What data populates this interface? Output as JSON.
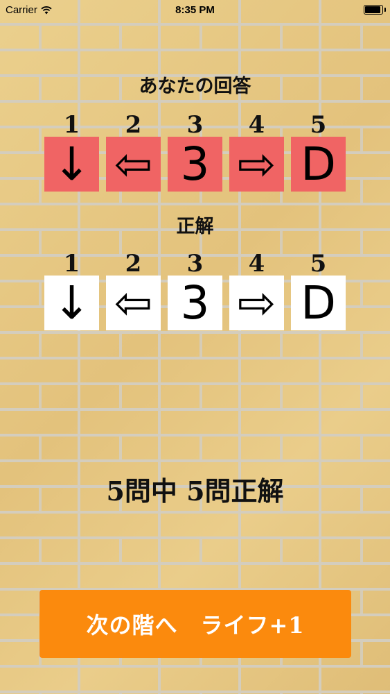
{
  "status_bar": {
    "carrier": "Carrier",
    "time": "8:35 PM",
    "battery_level": 1.0
  },
  "answer_section": {
    "title": "あなたの回答",
    "items": [
      {
        "number": "1",
        "symbol": "↓",
        "icon": "arrow-down-icon"
      },
      {
        "number": "2",
        "symbol": "⇦",
        "icon": "arrow-left-icon"
      },
      {
        "number": "3",
        "symbol": "3"
      },
      {
        "number": "4",
        "symbol": "⇨",
        "icon": "arrow-right-icon"
      },
      {
        "number": "5",
        "symbol": "D"
      }
    ],
    "box_color": "#f06464"
  },
  "correct_section": {
    "title": "正解",
    "items": [
      {
        "number": "1",
        "symbol": "↓",
        "icon": "arrow-down-icon"
      },
      {
        "number": "2",
        "symbol": "⇦",
        "icon": "arrow-left-icon"
      },
      {
        "number": "3",
        "symbol": "3"
      },
      {
        "number": "4",
        "symbol": "⇨",
        "icon": "arrow-right-icon"
      },
      {
        "number": "5",
        "symbol": "D"
      }
    ],
    "box_color": "#ffffff"
  },
  "result": {
    "score_text": "5問中 5問正解"
  },
  "next_button": {
    "label": "次の階へ　ライフ+1",
    "color": "#fb8a0d"
  }
}
